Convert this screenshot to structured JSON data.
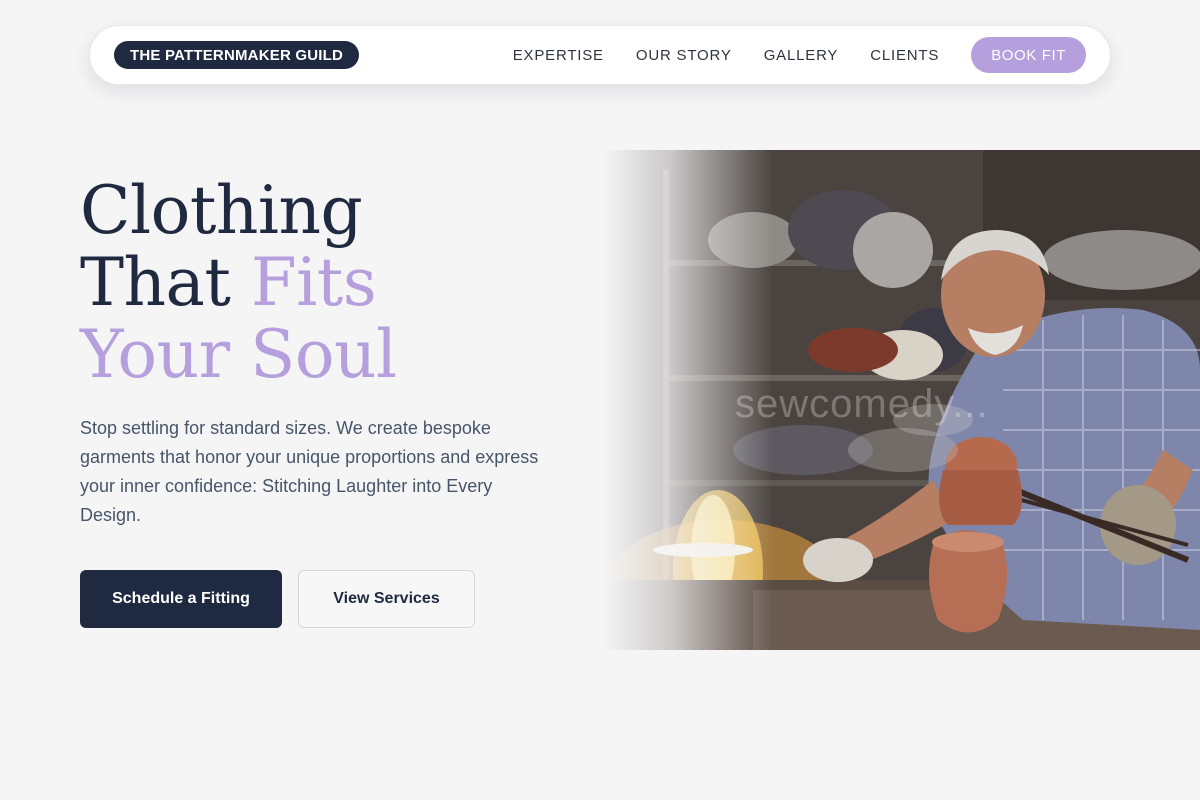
{
  "nav": {
    "brand": "THE PATTERNMAKER GUILD",
    "links": [
      "EXPERTISE",
      "OUR STORY",
      "GALLERY",
      "CLIENTS"
    ],
    "cta": "BOOK FIT"
  },
  "hero": {
    "title_line1": "Clothing",
    "title_line2_dark": "That ",
    "title_line2_accent": "Fits",
    "title_line3_accent": "Your Soul",
    "description": "Stop settling for standard sizes. We create bespoke garments that honor your unique proportions and express your inner confidence: Stitching Laughter into Every Design.",
    "primary_button": "Schedule a Fitting",
    "secondary_button": "View Services",
    "image_watermark": "sewcomedy..."
  },
  "colors": {
    "accent": "#b59fdc",
    "dark": "#1f2a40",
    "background": "#f5f5f6"
  }
}
